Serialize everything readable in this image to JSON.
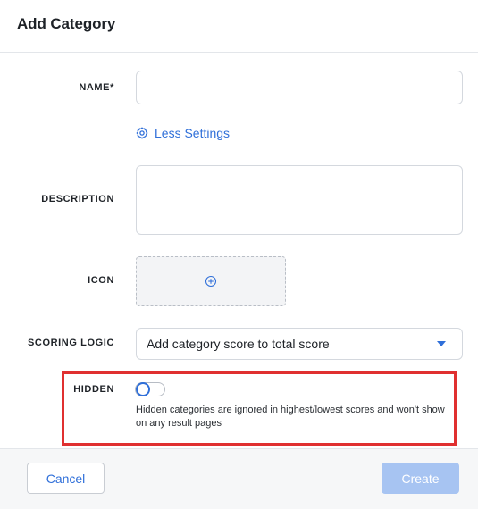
{
  "dialog": {
    "title": "Add Category"
  },
  "form": {
    "name_label": "NAME*",
    "name_value": "",
    "less_settings_label": "Less Settings",
    "description_label": "DESCRIPTION",
    "description_value": "",
    "icon_label": "ICON",
    "icon_add_icon": "plus-circle-icon",
    "scoring_logic_label": "SCORING LOGIC",
    "scoring_logic_value": "Add category score to total score",
    "hidden_label": "HIDDEN",
    "hidden_enabled": false,
    "hidden_hint": "Hidden categories are ignored in highest/lowest scores and won't show on any result pages"
  },
  "footer": {
    "cancel_label": "Cancel",
    "create_label": "Create"
  },
  "colors": {
    "accent": "#2f6fd9",
    "highlight_border": "#e03030",
    "create_disabled": "#a7c4f2"
  }
}
